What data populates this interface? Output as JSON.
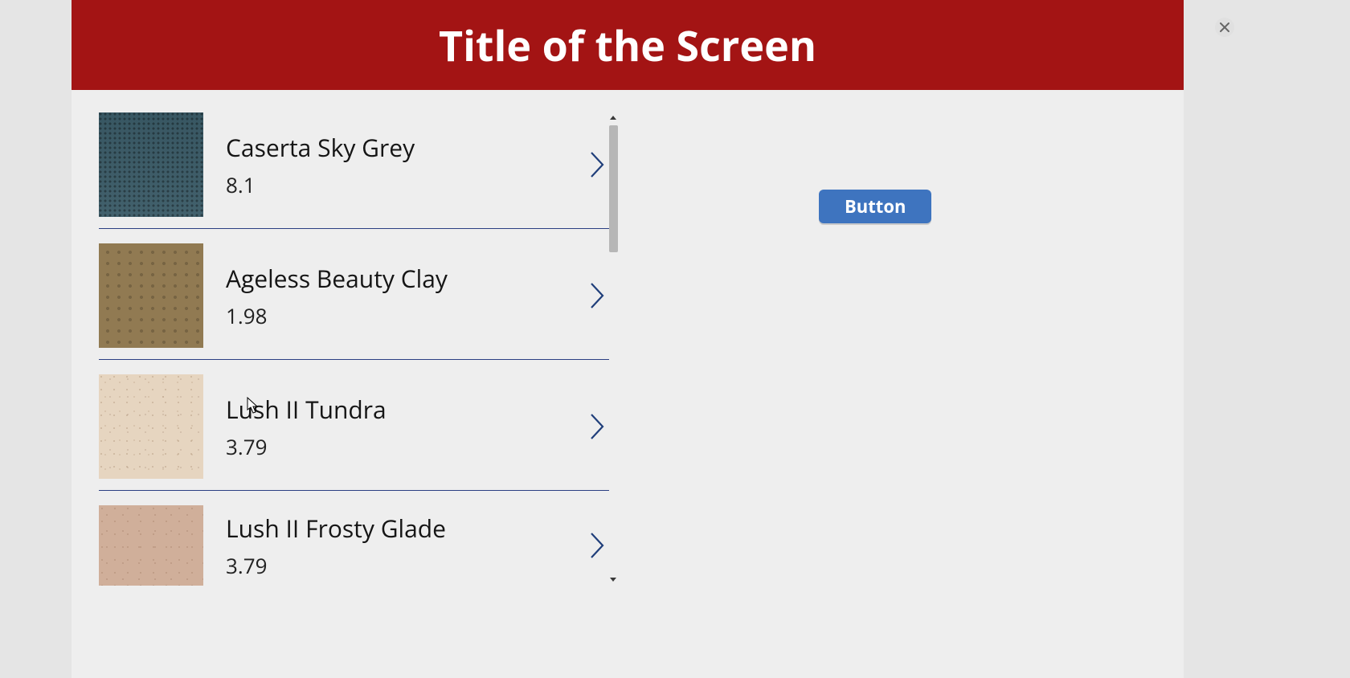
{
  "header": {
    "title": "Title of the Screen"
  },
  "list": {
    "items": [
      {
        "name": "Caserta Sky Grey",
        "value": "8.1",
        "icon": "swatch-caserta-sky-grey"
      },
      {
        "name": "Ageless Beauty Clay",
        "value": "1.98",
        "icon": "swatch-ageless-beauty-clay"
      },
      {
        "name": "Lush II Tundra",
        "value": "3.79",
        "icon": "swatch-lush-ii-tundra"
      },
      {
        "name": "Lush II Frosty Glade",
        "value": "3.79",
        "icon": "swatch-lush-ii-frosty-glade"
      }
    ]
  },
  "actions": {
    "primary_label": "Button"
  }
}
